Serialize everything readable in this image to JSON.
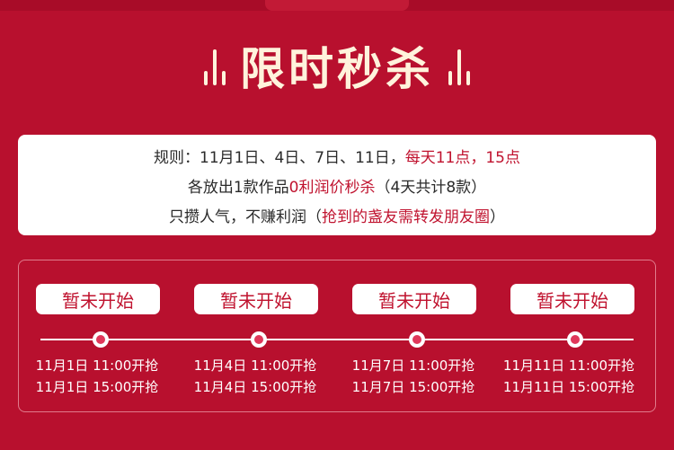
{
  "title": "限时秒杀",
  "rules": {
    "line1_prefix": "规则：11月1日、4日、7日、11日，",
    "line1_highlight": "每天11点，15点",
    "line2_prefix": "各放出1款作品",
    "line2_highlight": "0利润价秒杀",
    "line2_suffix": "（4天共计8款）",
    "line3_prefix": "只攒人气，不赚利润（",
    "line3_highlight": "抢到的盏友需转发朋友圈",
    "line3_suffix": "）"
  },
  "slots": [
    {
      "status": "暂未开始",
      "time1": "11月1日 11:00开抢",
      "time2": "11月1日 15:00开抢"
    },
    {
      "status": "暂未开始",
      "time1": "11月4日 11:00开抢",
      "time2": "11月4日 15:00开抢"
    },
    {
      "status": "暂未开始",
      "time1": "11月7日 11:00开抢",
      "time2": "11月7日 15:00开抢"
    },
    {
      "status": "暂未开始",
      "time1": "11月11日 11:00开抢",
      "time2": "11月11日 15:00开抢"
    }
  ],
  "colors": {
    "background": "#b8102e",
    "accent": "#c0132f",
    "title": "#fff3dc"
  }
}
